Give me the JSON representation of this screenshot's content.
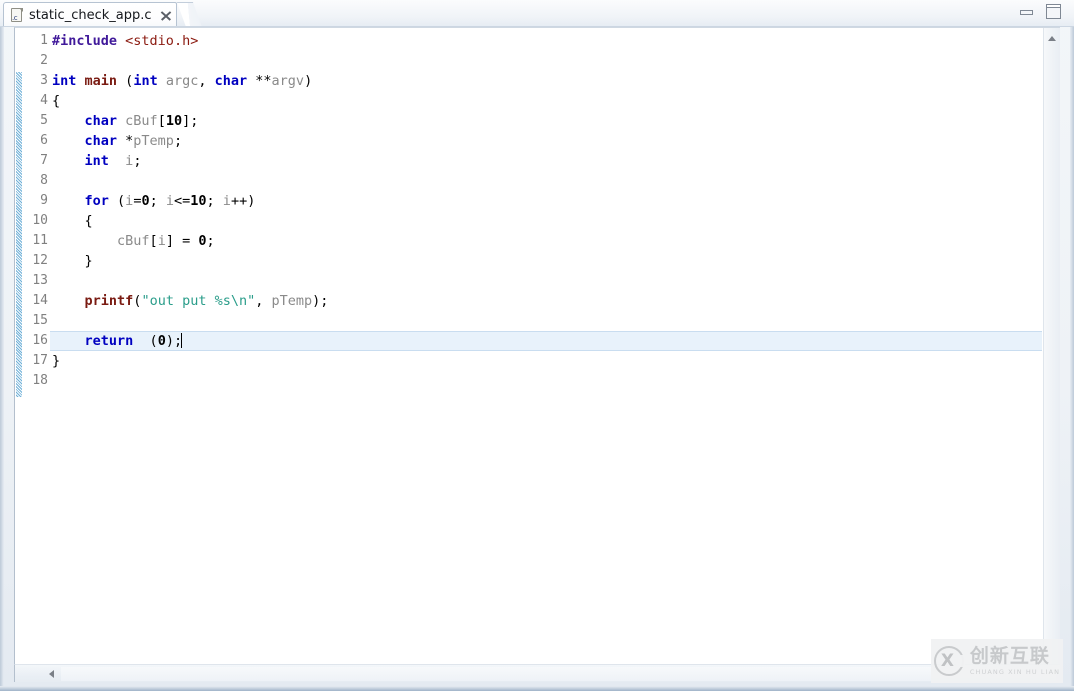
{
  "window": {
    "minimize_label": "Minimize",
    "maximize_label": "Maximize"
  },
  "tab": {
    "title": "static_check_app.c",
    "icon": "c-file-icon",
    "close_label": "×"
  },
  "editor": {
    "line_numbers": [
      "1",
      "2",
      "3",
      "4",
      "5",
      "6",
      "7",
      "8",
      "9",
      "10",
      "11",
      "12",
      "13",
      "14",
      "15",
      "16",
      "17",
      "18"
    ],
    "current_line": 16,
    "caret_line": 16,
    "lines": [
      {
        "n": "1",
        "tokens": [
          {
            "t": "#include",
            "c": "tok-pp"
          },
          {
            "t": " ",
            "c": "tok-plain"
          },
          {
            "t": "<stdio.h>",
            "c": "tok-inc"
          }
        ]
      },
      {
        "n": "2",
        "tokens": []
      },
      {
        "n": "3",
        "tokens": [
          {
            "t": "int",
            "c": "tok-kw"
          },
          {
            "t": " ",
            "c": "tok-plain"
          },
          {
            "t": "main",
            "c": "tok-fn"
          },
          {
            "t": " (",
            "c": "tok-plain"
          },
          {
            "t": "int",
            "c": "tok-kw"
          },
          {
            "t": " ",
            "c": "tok-plain"
          },
          {
            "t": "argc",
            "c": "tok-id"
          },
          {
            "t": ", ",
            "c": "tok-plain"
          },
          {
            "t": "char",
            "c": "tok-kw"
          },
          {
            "t": " ",
            "c": "tok-plain"
          },
          {
            "t": "**",
            "c": "tok-plain"
          },
          {
            "t": "argv",
            "c": "tok-id"
          },
          {
            "t": ")",
            "c": "tok-plain"
          }
        ]
      },
      {
        "n": "4",
        "tokens": [
          {
            "t": "{",
            "c": "tok-plain"
          }
        ]
      },
      {
        "n": "5",
        "tokens": [
          {
            "t": "    ",
            "c": "tok-plain"
          },
          {
            "t": "char",
            "c": "tok-kw"
          },
          {
            "t": " ",
            "c": "tok-plain"
          },
          {
            "t": "cBuf",
            "c": "tok-id"
          },
          {
            "t": "[",
            "c": "tok-plain"
          },
          {
            "t": "10",
            "c": "tok-num"
          },
          {
            "t": "];",
            "c": "tok-plain"
          }
        ]
      },
      {
        "n": "6",
        "tokens": [
          {
            "t": "    ",
            "c": "tok-plain"
          },
          {
            "t": "char",
            "c": "tok-kw"
          },
          {
            "t": " *",
            "c": "tok-plain"
          },
          {
            "t": "pTemp",
            "c": "tok-id"
          },
          {
            "t": ";",
            "c": "tok-plain"
          }
        ]
      },
      {
        "n": "7",
        "tokens": [
          {
            "t": "    ",
            "c": "tok-plain"
          },
          {
            "t": "int",
            "c": "tok-kw"
          },
          {
            "t": "  ",
            "c": "tok-plain"
          },
          {
            "t": "i",
            "c": "tok-id"
          },
          {
            "t": ";",
            "c": "tok-plain"
          }
        ]
      },
      {
        "n": "8",
        "tokens": []
      },
      {
        "n": "9",
        "tokens": [
          {
            "t": "    ",
            "c": "tok-plain"
          },
          {
            "t": "for",
            "c": "tok-kw"
          },
          {
            "t": " (",
            "c": "tok-plain"
          },
          {
            "t": "i",
            "c": "tok-id"
          },
          {
            "t": "=",
            "c": "tok-plain"
          },
          {
            "t": "0",
            "c": "tok-num"
          },
          {
            "t": "; ",
            "c": "tok-plain"
          },
          {
            "t": "i",
            "c": "tok-id"
          },
          {
            "t": "<=",
            "c": "tok-plain"
          },
          {
            "t": "10",
            "c": "tok-num"
          },
          {
            "t": "; ",
            "c": "tok-plain"
          },
          {
            "t": "i",
            "c": "tok-id"
          },
          {
            "t": "++)",
            "c": "tok-plain"
          }
        ]
      },
      {
        "n": "10",
        "tokens": [
          {
            "t": "    {",
            "c": "tok-plain"
          }
        ]
      },
      {
        "n": "11",
        "tokens": [
          {
            "t": "        ",
            "c": "tok-plain"
          },
          {
            "t": "cBuf",
            "c": "tok-id"
          },
          {
            "t": "[",
            "c": "tok-plain"
          },
          {
            "t": "i",
            "c": "tok-id"
          },
          {
            "t": "] = ",
            "c": "tok-plain"
          },
          {
            "t": "0",
            "c": "tok-num"
          },
          {
            "t": ";",
            "c": "tok-plain"
          }
        ]
      },
      {
        "n": "12",
        "tokens": [
          {
            "t": "    }",
            "c": "tok-plain"
          }
        ]
      },
      {
        "n": "13",
        "tokens": []
      },
      {
        "n": "14",
        "tokens": [
          {
            "t": "    ",
            "c": "tok-plain"
          },
          {
            "t": "printf",
            "c": "tok-fn"
          },
          {
            "t": "(",
            "c": "tok-plain"
          },
          {
            "t": "\"out put %s\\n\"",
            "c": "tok-str"
          },
          {
            "t": ", ",
            "c": "tok-plain"
          },
          {
            "t": "pTemp",
            "c": "tok-id"
          },
          {
            "t": ");",
            "c": "tok-plain"
          }
        ]
      },
      {
        "n": "15",
        "tokens": []
      },
      {
        "n": "16",
        "tokens": [
          {
            "t": "    ",
            "c": "tok-plain"
          },
          {
            "t": "return",
            "c": "tok-kw"
          },
          {
            "t": "  (",
            "c": "tok-plain"
          },
          {
            "t": "0",
            "c": "tok-num"
          },
          {
            "t": ");",
            "c": "tok-plain"
          }
        ]
      },
      {
        "n": "17",
        "tokens": [
          {
            "t": "}",
            "c": "tok-plain"
          }
        ]
      },
      {
        "n": "18",
        "tokens": []
      }
    ]
  },
  "scrollbars": {
    "vertical_up_arrow": "scroll-up",
    "horizontal_left_arrow": "scroll-left"
  },
  "watermark": {
    "cn": "创新互联",
    "pinyin": "CHUANG XIN HU LIAN",
    "mark_letter": "X"
  },
  "colors": {
    "keyword": "#0000C0",
    "function": "#7A1B12",
    "preprocessor": "#40199A",
    "include_path": "#8B1A10",
    "identifier": "#8A8A8A",
    "string": "#2A9D8A",
    "current_line_bg": "#E8F2FB",
    "change_bar": "#C3E0F0"
  }
}
